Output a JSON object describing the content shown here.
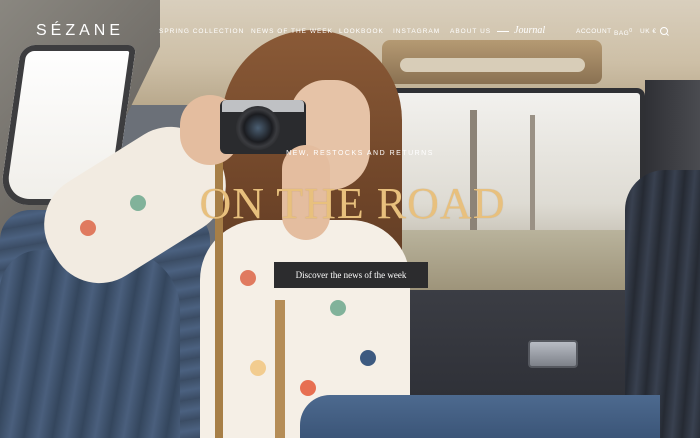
{
  "brand": {
    "logo_text": "SÉZANE"
  },
  "nav": {
    "items": [
      {
        "label": "SPRING COLLECTION"
      },
      {
        "label": "NEWS OF THE WEEK"
      },
      {
        "label": "LOOKBOOK"
      },
      {
        "label": "INSTAGRAM"
      },
      {
        "label": "ABOUT US"
      }
    ],
    "journal": "Journal"
  },
  "utility": {
    "account": "ACCOUNT",
    "bag": "BAG",
    "bag_count": "0",
    "locale": "UK €",
    "search_icon": "search-icon"
  },
  "hero": {
    "kicker": "NEW, RESTOCKS AND RETURNS",
    "headline": "ON THE ROAD",
    "cta_label": "Discover the news of the week"
  },
  "colors": {
    "headline": "#e8c07d",
    "cta_background": "#2c2c2e",
    "nav_text": "#ffffff"
  }
}
